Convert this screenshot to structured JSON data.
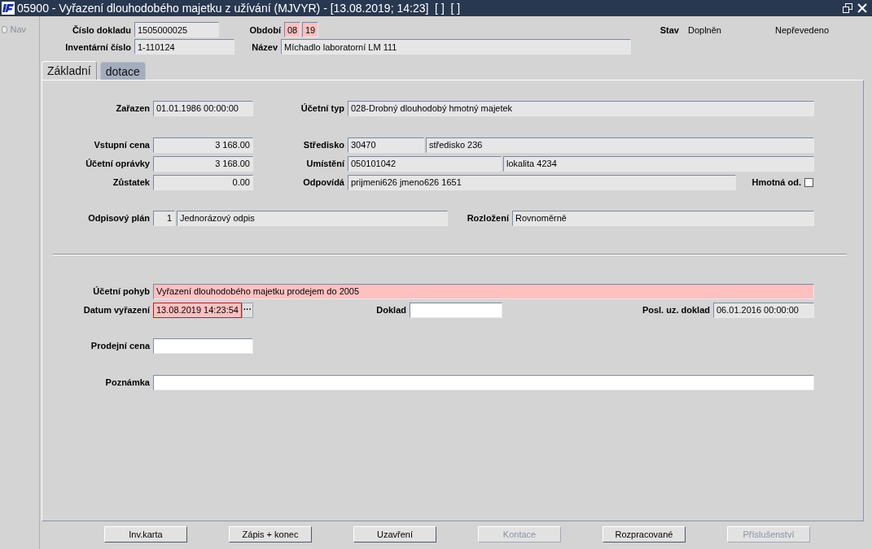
{
  "window": {
    "title": "05900 - Vyřazení dlouhodobého majetku z užívání (MJVYR) - [13.08.2019; 14:23]  [ ]  [ ]"
  },
  "nav": {
    "label": "Nav",
    "selected": false,
    "disabled": true
  },
  "header": {
    "rows": [
      {
        "items": [
          {
            "label": "Číslo dokladu",
            "fields": [
              {
                "value": "1505000025",
                "readonly": true,
                "required": false
              }
            ]
          },
          {
            "label": "Období",
            "fields": [
              {
                "value": "08",
                "required": true
              },
              {
                "value": "19",
                "required": true
              }
            ]
          },
          {
            "label": "Stav",
            "texts": [
              "Doplněn",
              "Nepřevedeno"
            ]
          }
        ]
      },
      {
        "items": [
          {
            "label": "Inventární číslo",
            "fields": [
              {
                "value": "1-110124",
                "readonly": true,
                "required": false
              }
            ]
          },
          {
            "label": "Název",
            "fields": [
              {
                "value": "Míchadlo laboratorní LM 111",
                "readonly": true,
                "required": false
              }
            ]
          }
        ]
      }
    ]
  },
  "tabs": [
    {
      "label": "Základní",
      "selected": true
    },
    {
      "label": "dotace",
      "selected": false
    }
  ],
  "sections": [
    {
      "rows": [
        {
          "items": [
            {
              "label": "Zařazen",
              "fields": [
                {
                  "value": "01.01.1986 00:00:00",
                  "readonly": true,
                  "required": false
                }
              ]
            },
            {
              "label": "Účetní typ",
              "fields": [
                {
                  "value": "028-Drobný dlouhodobý hmotný majetek",
                  "readonly": true,
                  "required": false
                }
              ]
            }
          ]
        },
        {
          "items": [
            {
              "label": "Vstupní cena",
              "fields": [
                {
                  "value": "3 168.00",
                  "readonly": true,
                  "required": false,
                  "numeric": true
                }
              ]
            },
            {
              "label": "Středisko",
              "fields": [
                {
                  "value": "30470",
                  "readonly": true,
                  "required": false
                },
                {
                  "value": "středisko 236",
                  "readonly": true,
                  "required": false
                }
              ]
            }
          ]
        },
        {
          "items": [
            {
              "label": "Účetní oprávky",
              "fields": [
                {
                  "value": "3 168.00",
                  "readonly": true,
                  "required": false,
                  "numeric": true
                }
              ]
            },
            {
              "label": "Umístění",
              "fields": [
                {
                  "value": "050101042",
                  "readonly": true,
                  "required": false
                },
                {
                  "value": "lokalita 4234",
                  "readonly": true,
                  "required": false
                }
              ]
            }
          ]
        },
        {
          "items": [
            {
              "label": "Zůstatek",
              "fields": [
                {
                  "value": "0.00",
                  "readonly": true,
                  "required": false,
                  "numeric": true
                }
              ]
            },
            {
              "label": "Odpovídá",
              "fields": [
                {
                  "value": "prijmeni626 jmeno626 1651",
                  "readonly": true,
                  "required": false
                }
              ]
            },
            {
              "label": "Hmotná od.",
              "checkbox": {
                "checked": false
              }
            }
          ]
        },
        {
          "items": [
            {
              "label": "Odpisový plán",
              "fields": [
                {
                  "value": "1",
                  "readonly": true,
                  "required": false,
                  "numeric": true
                },
                {
                  "value": "Jednorázový odpis",
                  "readonly": true,
                  "required": false
                }
              ]
            },
            {
              "label": "Rozložení",
              "fields": [
                {
                  "value": "Rovnoměrně",
                  "readonly": true,
                  "required": false
                }
              ]
            }
          ]
        }
      ]
    },
    {
      "rows": [
        {
          "items": [
            {
              "label": "Účetní pohyb",
              "fields": [
                {
                  "value": "Vyřazení dlouhodobého majetku prodejem do 2005",
                  "required": true
                }
              ]
            }
          ]
        },
        {
          "items": [
            {
              "label": "Datum vyřazení",
              "fields": [
                {
                  "value": "13.08.2019 14:23:54",
                  "required": true,
                  "focused": true,
                  "button": "···"
                }
              ]
            },
            {
              "label": "Doklad",
              "fields": [
                {
                  "readonly": false,
                  "required": false
                }
              ]
            },
            {
              "label": "Posl. uz. doklad",
              "fields": [
                {
                  "value": "06.01.2016 00:00:00",
                  "readonly": true,
                  "required": false
                }
              ]
            }
          ]
        },
        {
          "items": [
            {
              "label": "Prodejní cena",
              "fields": [
                {
                  "readonly": false,
                  "required": false
                }
              ]
            }
          ]
        },
        {
          "items": [
            {
              "label": "Poznámka",
              "fields": [
                {
                  "readonly": false,
                  "required": false
                }
              ]
            }
          ]
        }
      ]
    }
  ],
  "buttons": [
    {
      "label": "Inv.karta",
      "disabled": false
    },
    {
      "label": "Zápis + konec",
      "disabled": false
    },
    {
      "label": "Uzavření",
      "disabled": false
    },
    {
      "label": "Kontace",
      "disabled": true
    },
    {
      "label": "Rozpracované",
      "disabled": false
    },
    {
      "label": "Příslušenství",
      "disabled": true
    }
  ]
}
